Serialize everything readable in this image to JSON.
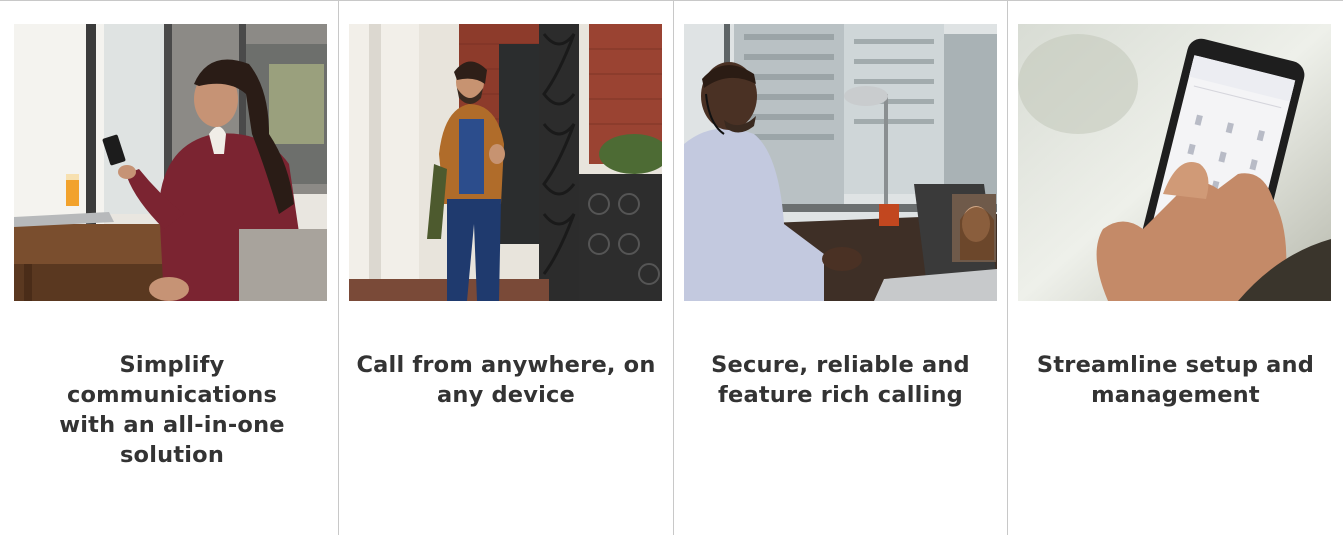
{
  "cards": [
    {
      "image": "woman-with-smartphone-in-cafe",
      "caption": "Simplify communications with an all-in-one solution"
    },
    {
      "image": "man-walking-with-phone-on-city-steps",
      "caption": "Call from anywhere, on any device"
    },
    {
      "image": "man-with-headset-on-video-call",
      "caption": "Secure, reliable and feature rich calling"
    },
    {
      "image": "hand-dialing-on-smartphone",
      "caption": "Streamline setup and management"
    }
  ],
  "colors": {
    "text": "#333333",
    "divider": "#c8c8c8",
    "background": "#ffffff"
  }
}
